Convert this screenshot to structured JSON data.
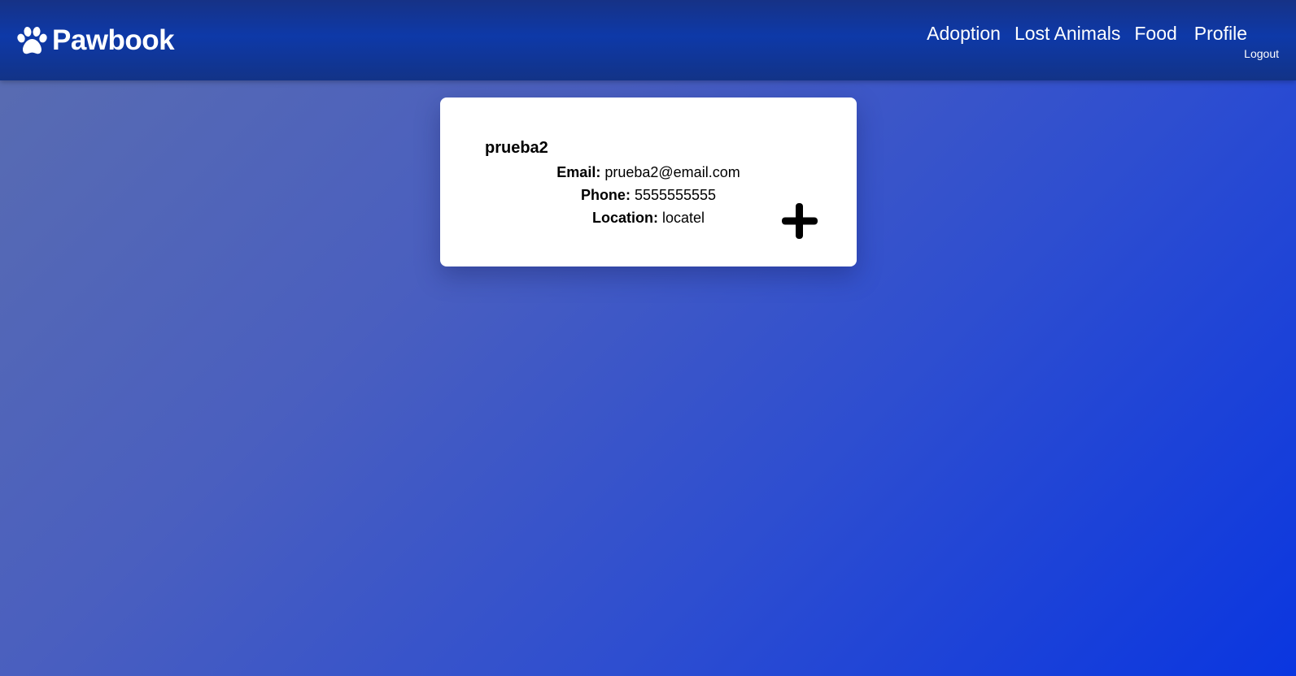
{
  "brand": {
    "name": "Pawbook",
    "icon": "paw-icon"
  },
  "nav": {
    "adoption": "Adoption",
    "lost_animals": "Lost Animals",
    "food": "Food",
    "profile": "Profile",
    "logout": "Logout"
  },
  "profile": {
    "username": "prueba2",
    "email_label": "Email:",
    "email": "prueba2@email.com",
    "phone_label": "Phone:",
    "phone": "5555555555",
    "location_label": "Location:",
    "location": "locatel",
    "add_icon": "plus-icon"
  },
  "colors": {
    "navbar": "#0e39a8",
    "background_start": "#5a6db0",
    "background_end": "#0a36e0",
    "card": "#ffffff"
  }
}
